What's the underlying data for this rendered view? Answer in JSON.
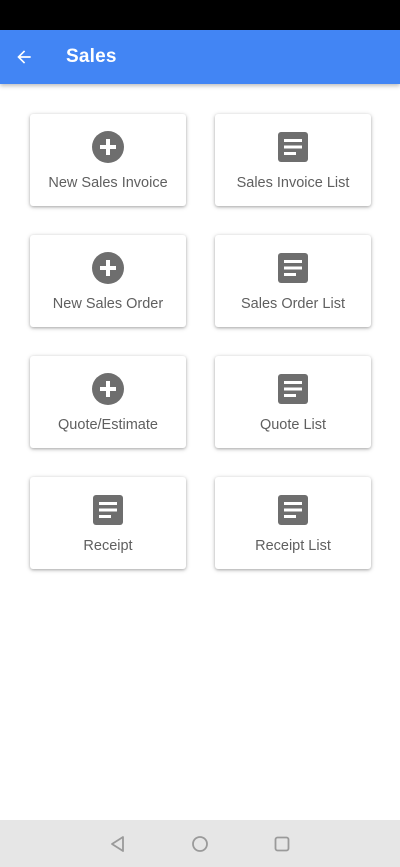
{
  "app_bar": {
    "title": "Sales",
    "back_icon": "arrow-back-icon",
    "color": "#4285f4"
  },
  "tiles": [
    {
      "label": "New Sales Invoice",
      "icon": "add-circle-icon"
    },
    {
      "label": "Sales Invoice List",
      "icon": "document-list-icon"
    },
    {
      "label": "New Sales Order",
      "icon": "add-circle-icon"
    },
    {
      "label": "Sales Order List",
      "icon": "document-list-icon"
    },
    {
      "label": "Quote/Estimate",
      "icon": "add-circle-icon"
    },
    {
      "label": "Quote List",
      "icon": "document-list-icon"
    },
    {
      "label": "Receipt",
      "icon": "document-list-icon"
    },
    {
      "label": "Receipt List",
      "icon": "document-list-icon"
    }
  ],
  "nav_bar": {
    "back_icon": "triangle-back-icon",
    "home_icon": "circle-home-icon",
    "recents_icon": "square-recents-icon"
  },
  "colors": {
    "icon": "#6e6e6e",
    "label": "#5f5f5f",
    "status_bar": "#000000",
    "nav_bar": "#e6e6e6"
  }
}
